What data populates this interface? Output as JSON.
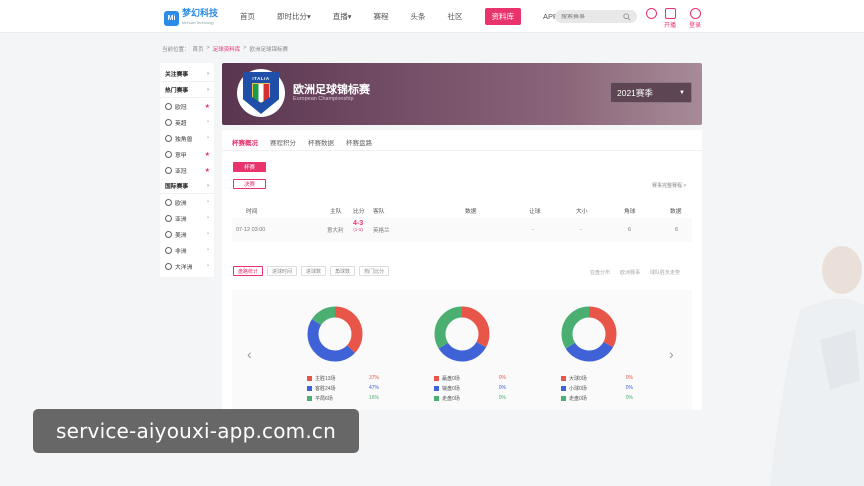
{
  "nav": {
    "logo_mark": "Mi",
    "logo_text": "梦幻科技",
    "logo_sub": "Meihuan Technology",
    "links": [
      {
        "label": "首页",
        "active": false
      },
      {
        "label": "即时比分▾",
        "active": false
      },
      {
        "label": "直播▾",
        "active": false
      },
      {
        "label": "赛程",
        "active": false
      },
      {
        "label": "头条",
        "active": false
      },
      {
        "label": "社区",
        "active": false
      },
      {
        "label": "资料库",
        "active": true
      },
      {
        "label": "APP下载",
        "active": false
      }
    ],
    "search_placeholder": "搜索赛事",
    "open_label": "开播",
    "login_label": "登录"
  },
  "breadcrumb": {
    "current": "当前位置：",
    "home": "首页",
    "db": "足球资料库",
    "page": "欧洲足球锦标赛"
  },
  "sidebar": {
    "items": [
      {
        "label": "关注赛事",
        "kind": "header"
      },
      {
        "label": "热门赛事",
        "kind": "header"
      },
      {
        "label": "欧冠",
        "kind": "item",
        "star": true
      },
      {
        "label": "英超",
        "kind": "item",
        "star": false
      },
      {
        "label": "独角兽",
        "kind": "item",
        "star": false
      },
      {
        "label": "意甲",
        "kind": "item",
        "star": true
      },
      {
        "label": "亚冠",
        "kind": "item",
        "star": true
      },
      {
        "label": "国际赛事",
        "kind": "header"
      },
      {
        "label": "欧洲",
        "kind": "item",
        "star": false
      },
      {
        "label": "亚洲",
        "kind": "item",
        "star": false
      },
      {
        "label": "美洲",
        "kind": "item",
        "star": false
      },
      {
        "label": "非洲",
        "kind": "item",
        "star": false
      },
      {
        "label": "大洋洲",
        "kind": "item",
        "star": false
      }
    ]
  },
  "hero": {
    "crest_text": "ITALIA",
    "title": "欧洲足球锦标赛",
    "subtitle": "European Championship",
    "season": "2021赛季"
  },
  "tabs": [
    "杯赛概况",
    "赛程积分",
    "杯赛数据",
    "杯赛盘路"
  ],
  "stages": {
    "final": "杯赛",
    "decider": "决赛"
  },
  "rank_link": "赛事完整赛程 >",
  "table": {
    "headers": [
      "时间",
      "主队",
      "比分",
      "客队",
      "数据",
      "让球",
      "大小",
      "角球",
      "数据"
    ],
    "rows": [
      {
        "time": "07-12 03:00",
        "home": "意大利",
        "score": "4-3",
        "score_sub": "(1-1)",
        "away": "英格兰",
        "data": "",
        "handicap": "-",
        "ou": "-",
        "corner": "6",
        "stat": "6"
      }
    ]
  },
  "stat_tabs": [
    "盘路统计",
    "进球时间",
    "进球数",
    "角球数",
    "热门比分"
  ],
  "stat_opts": [
    "亚盘分布",
    "欧洲赛事",
    "球队胜负走势"
  ],
  "donuts": [
    {
      "segments": [
        {
          "label": "主胜13场",
          "value": "37%",
          "color": "#e8564a",
          "pct": 37
        },
        {
          "label": "客胜24场",
          "value": "47%",
          "color": "#3f63d6",
          "pct": 47
        },
        {
          "label": "平局6场",
          "value": "16%",
          "color": "#4caf72",
          "pct": 16
        }
      ]
    },
    {
      "segments": [
        {
          "label": "赢盘0场",
          "value": "0%",
          "color": "#e8564a",
          "pct": 33
        },
        {
          "label": "输盘0场",
          "value": "0%",
          "color": "#3f63d6",
          "pct": 33
        },
        {
          "label": "走盘0场",
          "value": "0%",
          "color": "#4caf72",
          "pct": 34
        }
      ]
    },
    {
      "segments": [
        {
          "label": "大球0场",
          "value": "0%",
          "color": "#e8564a",
          "pct": 33
        },
        {
          "label": "小球0场",
          "value": "0%",
          "color": "#3f63d6",
          "pct": 33
        },
        {
          "label": "走盘0场",
          "value": "0%",
          "color": "#4caf72",
          "pct": 34
        }
      ]
    }
  ],
  "watermark": "service-aiyouxi-app.com.cn",
  "colors": {
    "accent": "#e8336d",
    "red": "#e8564a",
    "blue": "#3f63d6",
    "green": "#4caf72"
  }
}
